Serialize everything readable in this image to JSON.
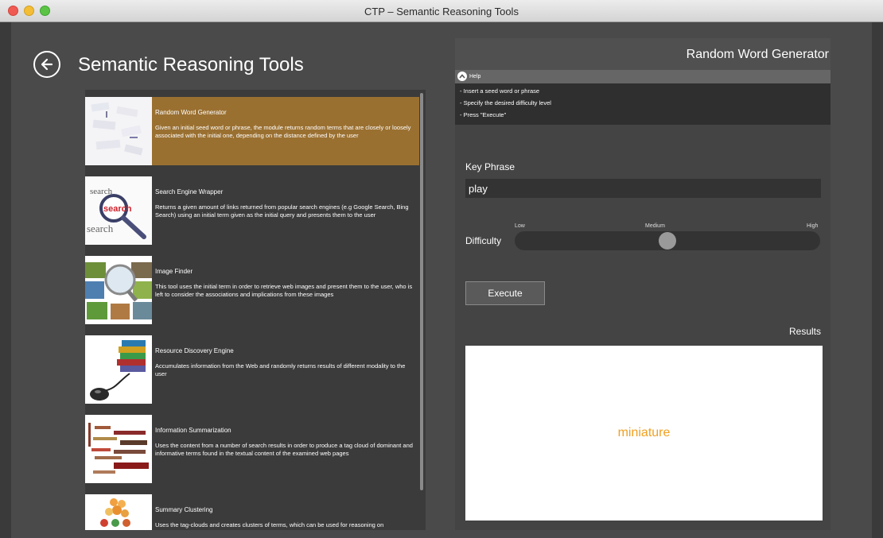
{
  "window": {
    "title": "CTP – Semantic Reasoning Tools"
  },
  "header": {
    "title": "Semantic Reasoning Tools"
  },
  "tools": [
    {
      "name": "Random Word Generator",
      "description": "Given an initial seed word or phrase, the module returns random terms that are closely or loosely associated with the initial one, depending on the distance defined by the user",
      "icon": "word-cloud-thumbnail",
      "selected": true
    },
    {
      "name": "Search Engine Wrapper",
      "description": "Returns a given amount of links returned from popular search engines (e.g Google Search, Bing Search) using an initial term given as the initial query and presents them to the user",
      "icon": "search-magnifier-thumbnail",
      "selected": false
    },
    {
      "name": "Image Finder",
      "description": "This tool uses the initial term in order to retrieve web images and present them to the user, who is left to consider the associations and implications from these images",
      "icon": "image-collage-thumbnail",
      "selected": false
    },
    {
      "name": "Resource Discovery Engine",
      "description": "Accumulates information from the Web and randomly returns results of different modality to the user",
      "icon": "books-mouse-thumbnail",
      "selected": false
    },
    {
      "name": "Information Summarization",
      "description": "Uses the content from a number of search results in order to produce a tag cloud of dominant and informative terms found in the textual content of the examined web pages",
      "icon": "tag-cloud-thumbnail",
      "selected": false
    },
    {
      "name": "Summary Clustering",
      "description": "Uses the tag-clouds and creates clusters of terms, which can be used for reasoning on",
      "icon": "cluster-thumbnail",
      "selected": false
    }
  ],
  "panel": {
    "title": "Random Word Generator",
    "help": {
      "label": "Help",
      "lines": [
        "- Insert a seed word or phrase",
        "- Specify the desired difficulty level",
        "- Press \"Execute\""
      ]
    },
    "key_phrase": {
      "label": "Key Phrase",
      "value": "play"
    },
    "difficulty": {
      "label": "Difficulty",
      "levels": [
        "Low",
        "Medium",
        "High"
      ],
      "value_fraction": 0.5
    },
    "execute_label": "Execute",
    "results": {
      "label": "Results",
      "value": "miniature"
    }
  },
  "colors": {
    "selected_item": "#9a7031",
    "result_text": "#f0a020"
  }
}
